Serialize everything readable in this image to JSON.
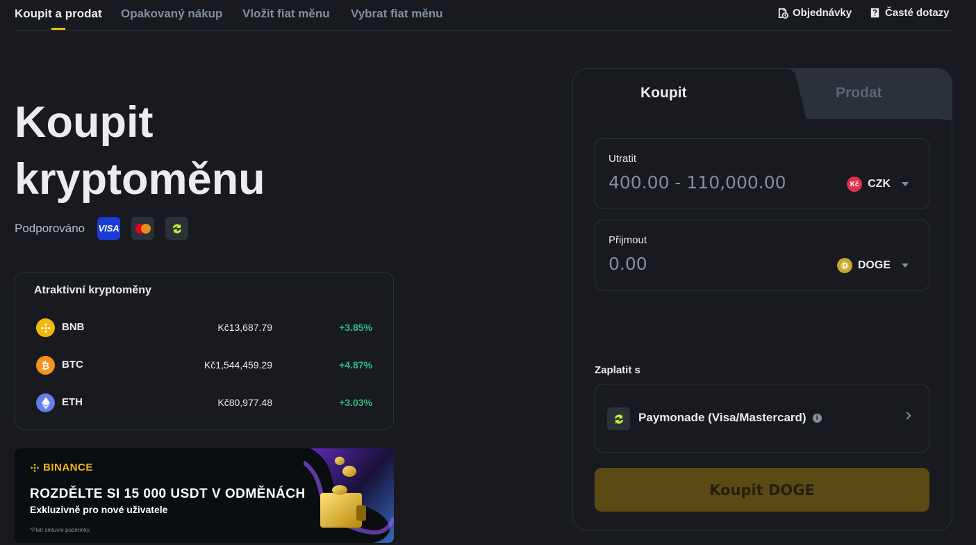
{
  "nav": {
    "tabs": [
      {
        "label": "Koupit a prodat"
      },
      {
        "label": "Opakovaný nákup"
      },
      {
        "label": "Vložit fiat měnu"
      },
      {
        "label": "Vybrat fiat měnu"
      }
    ],
    "orders_label": "Objednávky",
    "faq_label": "Časté dotazy"
  },
  "hero": {
    "title_line1": "Koupit",
    "title_line2": "kryptoměnu",
    "supported_label": "Podporováno",
    "visa_text": "VISA"
  },
  "crypto_list": {
    "title": "Atraktivní kryptoměny",
    "items": [
      {
        "symbol": "BNB",
        "price": "Kč13,687.79",
        "change": "+3.85%"
      },
      {
        "symbol": "BTC",
        "price": "Kč1,544,459.29",
        "change": "+4.87%"
      },
      {
        "symbol": "ETH",
        "price": "Kč80,977.48",
        "change": "+3.03%"
      }
    ]
  },
  "banner": {
    "brand": "BINANCE",
    "headline": "ROZDĚLTE SI 15 000 USDT V ODMĚNÁCH",
    "subline": "Exkluzivně pro nové uživatele",
    "note": "*Platí smluvní podmínky."
  },
  "trade": {
    "buy_tab": "Koupit",
    "sell_tab": "Prodat",
    "spend_label": "Utratit",
    "spend_placeholder": "400.00 - 110,000.00",
    "spend_currency": "CZK",
    "spend_currency_icon": "Kč",
    "receive_label": "Přijmout",
    "receive_placeholder": "0.00",
    "receive_currency": "DOGE",
    "pay_with_label": "Zaplatit s",
    "payment_method": "Paymonade (Visa/Mastercard)",
    "info_glyph": "i",
    "buy_button": "Koupit DOGE"
  },
  "colors": {
    "background": "#181a20",
    "border": "#2b3139",
    "accent": "#f0b90b",
    "positive": "#2ebd85",
    "buy_button_disabled": "#5b4a14"
  }
}
